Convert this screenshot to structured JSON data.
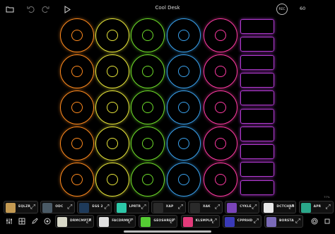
{
  "header": {
    "title": "Cool Desk",
    "rec_label": "REC",
    "bpm": "60",
    "icons": {
      "folder": "folder-icon",
      "undo": "undo-icon",
      "redo": "redo-icon",
      "play": "play-icon"
    }
  },
  "grid": {
    "columns": [
      {
        "color": "#ff8a1e"
      },
      {
        "color": "#e8e63a"
      },
      {
        "color": "#6fdd2a"
      },
      {
        "color": "#3aa2ee"
      },
      {
        "color": "#ff3aa3"
      }
    ],
    "loop_color": "#b23ad0"
  },
  "fx_row1": [
    {
      "label": "EQLZR",
      "thumb": "#c49a52"
    },
    {
      "label": "ODC",
      "thumb": "#4a5a66"
    },
    {
      "label": "EGS 2",
      "thumb": "#1e3a5a"
    },
    {
      "label": "LPRTR",
      "thumb": "#2cc8a8"
    },
    {
      "label": "XAP",
      "thumb": "#2a2a2a"
    },
    {
      "label": "XAK",
      "thumb": "#2a2a2a"
    },
    {
      "label": "CYKLE",
      "thumb": "#7a44b8"
    },
    {
      "label": "DCTCHRN",
      "thumb": "#e8e8e8"
    },
    {
      "label": "APR",
      "thumb": "#2aa88a"
    }
  ],
  "fx_row2": [
    {
      "label": "DRMCMPTR",
      "thumb": "#d8d8c8"
    },
    {
      "label": "FACDRMKT",
      "thumb": "#e0e0e0"
    },
    {
      "label": "GEOSHRED",
      "thumb": "#55cc33"
    },
    {
      "label": "KLSMPLR",
      "thumb": "#e23a7a"
    },
    {
      "label": "CPPRHD",
      "thumb": "#3a3ab8"
    },
    {
      "label": "BORSTA",
      "thumb": "#7a6ab8"
    }
  ],
  "footer": {
    "left_icons": [
      "mixer-icon",
      "grid-icon",
      "pencil-icon",
      "settings-circle-icon"
    ],
    "right_icons": [
      "circle-icon",
      "stop-icon"
    ],
    "corner_text": "77%"
  }
}
